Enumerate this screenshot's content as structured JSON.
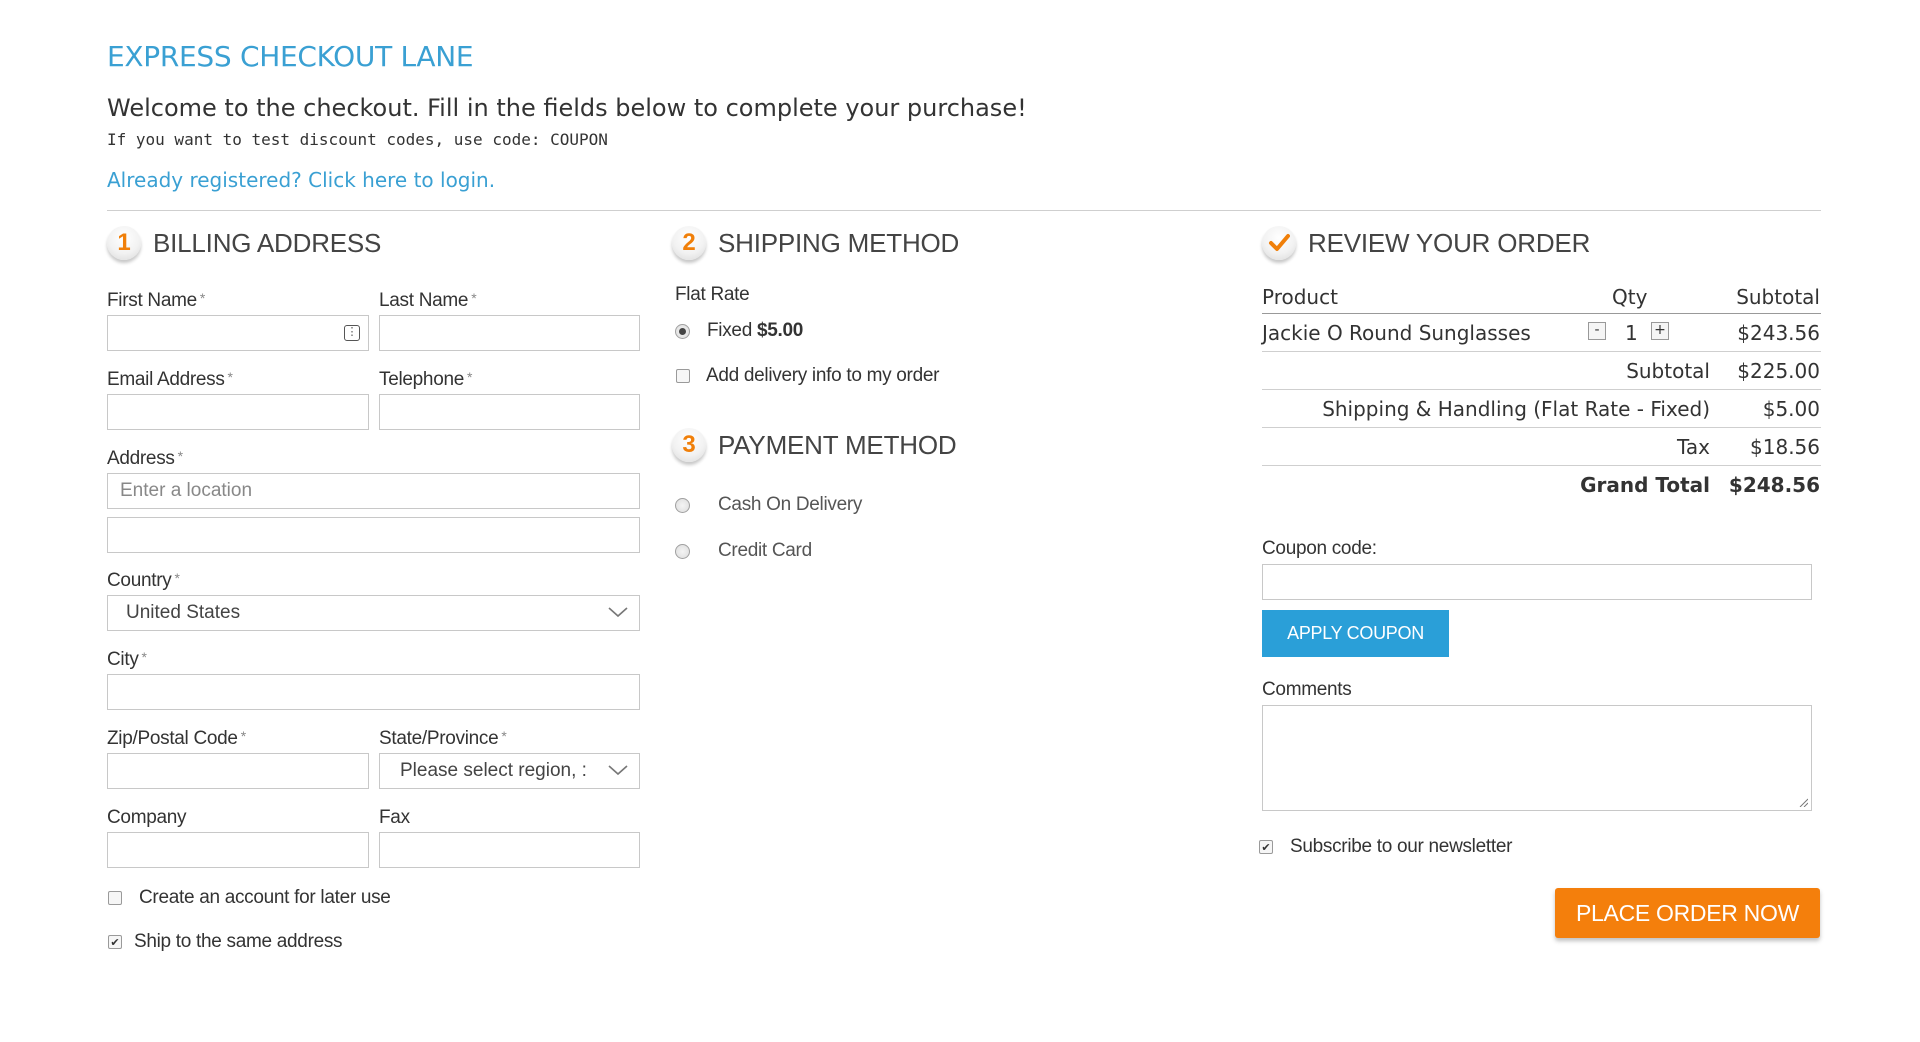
{
  "header": {
    "title": "EXPRESS CHECKOUT LANE",
    "welcome": "Welcome to the checkout. Fill in the fields below to complete your purchase!",
    "hint": "If you want to test discount codes, use code: COUPON",
    "login_link": "Already registered? Click here to login."
  },
  "billing": {
    "step": "1",
    "title": "BILLING ADDRESS",
    "first_name_label": "First Name",
    "last_name_label": "Last Name",
    "email_label": "Email Address",
    "telephone_label": "Telephone",
    "address_label": "Address",
    "address_placeholder": "Enter a location",
    "country_label": "Country",
    "country_value": "United States",
    "city_label": "City",
    "zip_label": "Zip/Postal Code",
    "state_label": "State/Province",
    "state_placeholder": "Please select region, :",
    "company_label": "Company",
    "fax_label": "Fax",
    "required_mark": "*",
    "create_account_label": "Create an account for later use",
    "ship_same_label": "Ship to the same address"
  },
  "shipping": {
    "step": "2",
    "title": "SHIPPING METHOD",
    "group_label": "Flat Rate",
    "option_label": "Fixed",
    "option_price": "$5.00",
    "delivery_info_label": "Add delivery info to my order"
  },
  "payment": {
    "step": "3",
    "title": "PAYMENT METHOD",
    "options": [
      "Cash On Delivery",
      "Credit Card"
    ]
  },
  "review": {
    "title": "REVIEW YOUR ORDER",
    "col_product": "Product",
    "col_qty": "Qty",
    "col_subtotal": "Subtotal",
    "item_name": "Jackie O Round Sunglasses",
    "item_qty": "1",
    "item_subtotal": "$243.56",
    "qty_minus": "-",
    "qty_plus": "+",
    "subtotal_label": "Subtotal",
    "subtotal_value": "$225.00",
    "shipping_label": "Shipping & Handling (Flat Rate - Fixed)",
    "shipping_value": "$5.00",
    "tax_label": "Tax",
    "tax_value": "$18.56",
    "grand_total_label": "Grand Total",
    "grand_total_value": "$248.56",
    "coupon_label": "Coupon code:",
    "apply_coupon": "APPLY COUPON",
    "comments_label": "Comments",
    "newsletter_label": "Subscribe to our newsletter",
    "place_order": "PLACE ORDER NOW"
  },
  "colors": {
    "link_blue": "#3aa0d3",
    "button_blue": "#2a9fd8",
    "button_orange": "#f47f0c",
    "step_orange": "#f07f09"
  }
}
